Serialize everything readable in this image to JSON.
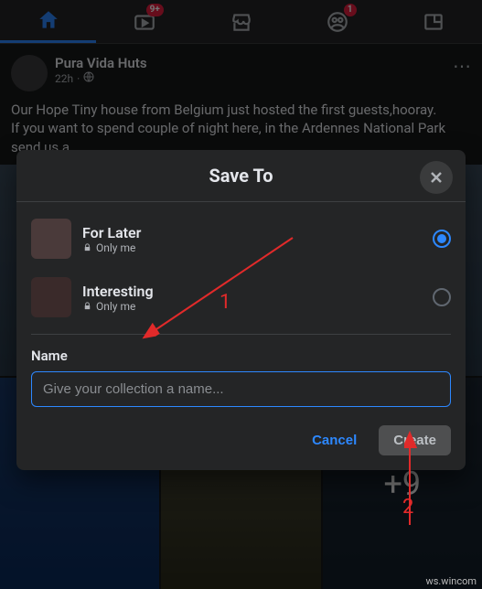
{
  "topnav": {
    "watch_badge": "9+",
    "groups_badge": "1"
  },
  "post": {
    "author": "Pura Vida Huts",
    "timestamp": "22h",
    "privacy_icon": "globe-icon",
    "body": "Our Hope Tiny house from Belgium just hosted the first guests,hooray.\nIf you want to spend couple of night here, in the Ardennes National Park send us a",
    "more_photos": "+9"
  },
  "modal": {
    "title": "Save To",
    "collections": [
      {
        "name": "For Later",
        "privacy": "Only me",
        "selected": true
      },
      {
        "name": "Interesting",
        "privacy": "Only me",
        "selected": false
      }
    ],
    "field_label": "Name",
    "field_placeholder": "Give your collection a name...",
    "cancel_label": "Cancel",
    "create_label": "Create"
  },
  "annotations": {
    "label1": "1",
    "label2": "2"
  },
  "watermark": "ws.wincom"
}
